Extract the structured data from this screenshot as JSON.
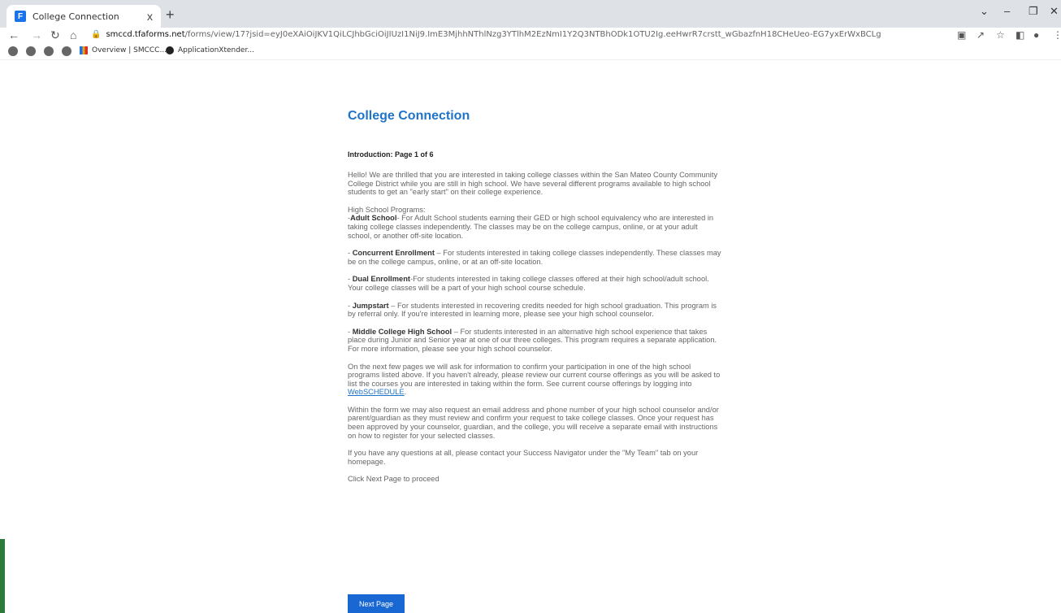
{
  "browser": {
    "tab_title": "College Connection",
    "tab_close": "x",
    "new_tab": "+",
    "url_domain": "smccd.tfaforms.net",
    "url_rest": "/forms/view/17?jsid=eyJ0eXAiOiJKV1QiLCJhbGciOiJIUzI1NiJ9.ImE3MjhhNThlNzg3YTlhM2EzNmI1Y2Q3NTBhODk1OTU2Ig.eeHwrR7crstt_wGbazfnH18CHeUeo-EG7yxErWxBCLg",
    "bookmarks": [
      {
        "label": "Overview | SMCCC..."
      },
      {
        "label": "ApplicationXtender..."
      }
    ]
  },
  "form": {
    "title": "College Connection",
    "page_label": "Introduction: Page 1 of 6",
    "intro": "Hello! We are thrilled that you are interested in taking college classes within the San Mateo County Community College District while you are still in high school.  We have several different programs available to high school students to get an \"early start\" on their college experience.",
    "programs_heading": "High School Programs:",
    "adult_prefix": "-",
    "adult_name": "Adult School",
    "adult_text": "- For Adult School students earning their GED or high school equivalency who are interested in taking college classes independently. The classes may be on the college campus, online, or at your adult school, or another off-site location.",
    "concurrent_prefix": "- ",
    "concurrent_name": "Concurrent Enrollment",
    "concurrent_text": " – For students interested in taking college classes independently. These classes may be on the college campus, online, or at an off-site location.",
    "dual_prefix": "- ",
    "dual_name": "Dual Enrollment",
    "dual_text": "-For students interested in taking college classes offered at their high school/adult school.  Your college classes will be a part of your high school course schedule.",
    "jumpstart_prefix": "- ",
    "jumpstart_name": "Jumpstart",
    "jumpstart_text": " – For students interested in recovering credits needed for high school graduation.  This program is by referral only.  If you're interested in learning more, please see your high school counselor.",
    "middle_prefix": "- ",
    "middle_name": "Middle College High School",
    "middle_text": " – For students interested in an alternative high school experience that takes place during Junior and Senior year at one of our three colleges.  This program requires a separate application.  For more information, please see your high school counselor.",
    "next_pages_text": "On the next few pages we will ask for information to confirm your participation in one of the high school programs listed above.  If you haven't already, please review our current course offerings as you will be asked to list the courses you are interested in taking within the form. See current course offerings by logging into ",
    "webschedule_link": "WebSCHEDULE",
    "period": ".",
    "email_text": "Within the form we may also request an email address and phone number of your high school counselor and/or parent/guardian as they must review and confirm your request to take college classes.  Once your request has been approved by your counselor, guardian, and the college, you will receive a separate email with instructions on how to register for your selected classes.",
    "questions_text": "If you have any questions at all, please contact your Success Navigator under the \"My Team\" tab on your homepage.",
    "proceed_text": "Click Next Page to proceed",
    "next_button": "Next Page"
  }
}
